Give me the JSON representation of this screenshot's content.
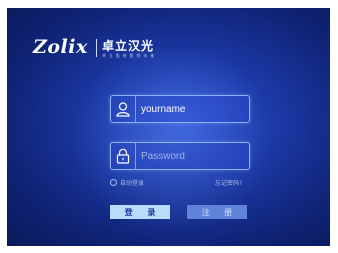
{
  "brand": {
    "logo_text": "Zolix",
    "name_cn": "卓立汉光",
    "slogan": "卓 立 股 份  智 领 未 来"
  },
  "login": {
    "username": {
      "value": "yourname",
      "icon": "user-icon"
    },
    "password": {
      "placeholder": "Password",
      "icon": "lock-icon"
    },
    "remember_label": "自动登录",
    "forgot_label": "忘记密码?",
    "login_button": "登 录",
    "register_button": "注 册"
  },
  "colors": {
    "background": "#1c3aa8",
    "login_button_bg": "#b9dcfb",
    "register_button_bg": "#5f83d6"
  }
}
